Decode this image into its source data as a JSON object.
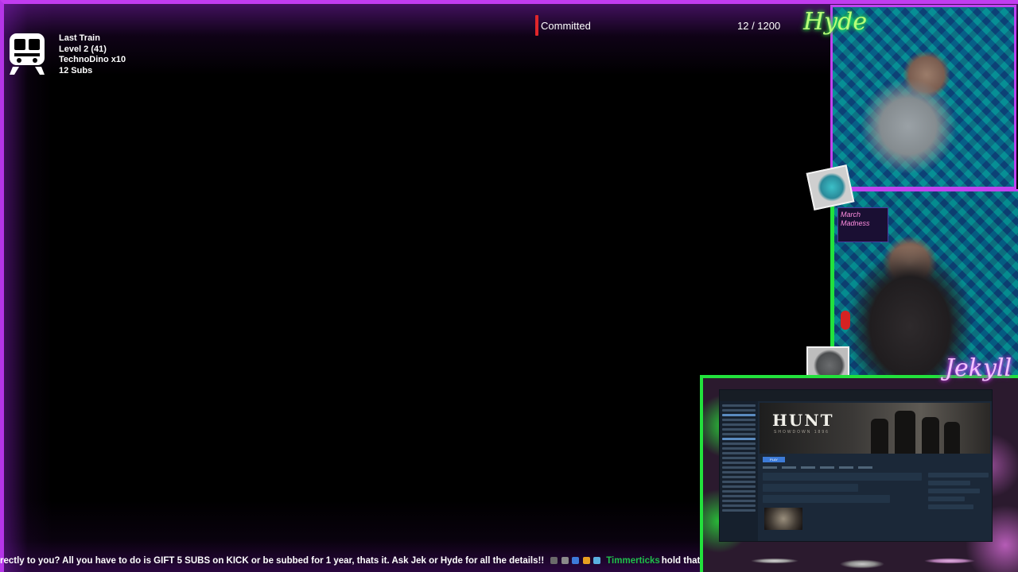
{
  "train": {
    "icon": "train-icon",
    "title": "Last Train",
    "level": "Level 2  (41)",
    "contributor": "TechnoDino x10",
    "subs": "12 Subs"
  },
  "goal": {
    "label": "Committed",
    "count": "12 / 1200",
    "accent": "#e0262a"
  },
  "overlay": {
    "script_top": "Hyde",
    "script_bottom": "Jekyll",
    "frame_color": "#c23cf0",
    "green_accent": "#22e23c"
  },
  "cam_bottom": {
    "sign_text": "March Madness"
  },
  "game": {
    "title": "HUNT",
    "subtitle": "SHOWDOWN 1896",
    "play_label": "PLAY"
  },
  "ticker": {
    "message": "rectly to you? All you have to do is GIFT 5 SUBS on KICK or be subbed for 1 year, thats it. Ask Jek or Hyde for all the details!!",
    "chat_username": "Timmerticks",
    "chat_message": "hold that thought lol",
    "username_color": "#1fbf4a"
  }
}
